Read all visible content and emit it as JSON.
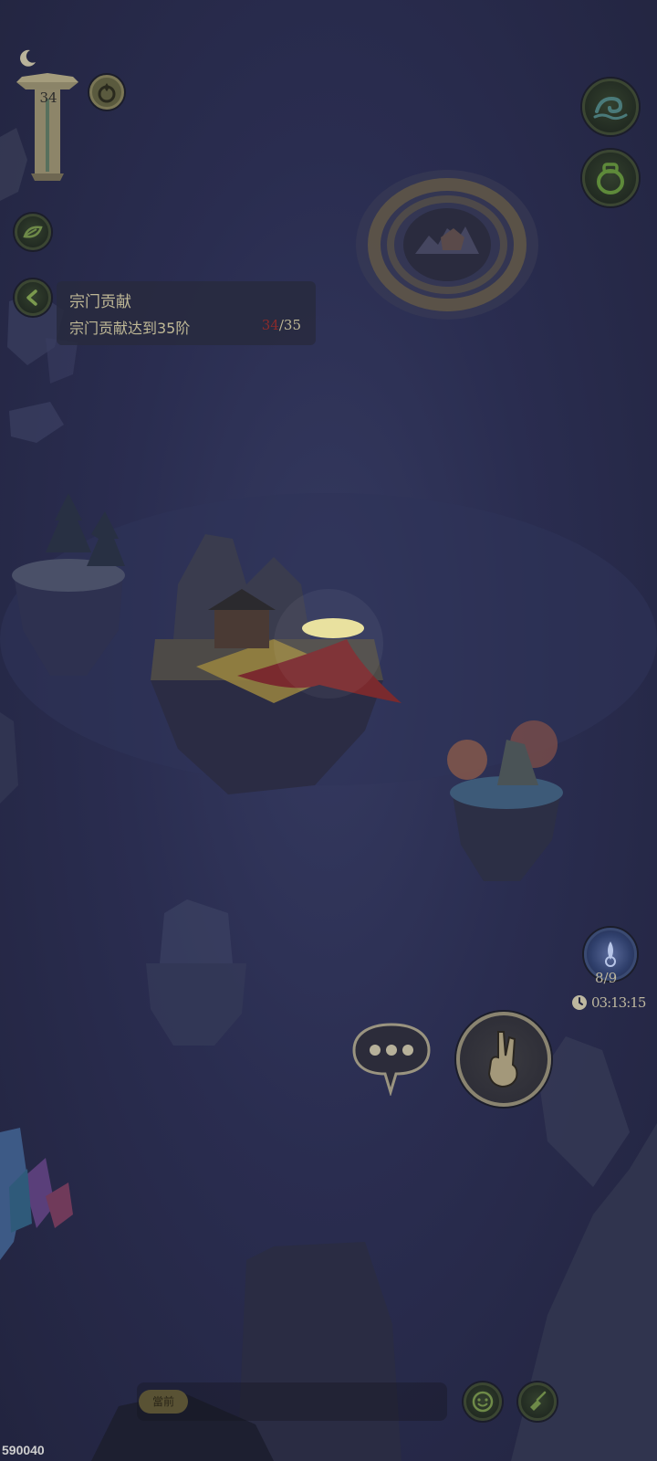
{
  "hud": {
    "level": "34",
    "quest": {
      "title": "宗门贡献",
      "description": "宗门贡献达到35阶",
      "current": "34",
      "target": "/35"
    },
    "energy": {
      "count": "8/9",
      "timer": "03:13:15"
    }
  },
  "chat": {
    "channel_label": "當前"
  },
  "footer": {
    "player_id": "590040"
  },
  "icons": {
    "moon": "moon-icon",
    "level_pillar": "pillar-icon",
    "fire_ring": "fire-ring-icon",
    "wave": "wave-icon",
    "pot": "pot-icon",
    "leaf": "leaf-icon",
    "back": "chevron-left-icon",
    "vortex": "vortex-portal-icon",
    "orb": "spirit-orb-icon",
    "clock": "clock-icon",
    "chat_bubble": "chat-bubble-icon",
    "hand": "hand-gesture-icon",
    "emoji": "emoji-icon",
    "settings": "brush-icon"
  },
  "colors": {
    "background": "#2a2d50",
    "button_fill": "#2a352a",
    "quest_progress_current": "#8a2b2b",
    "text": "#bfb896"
  }
}
